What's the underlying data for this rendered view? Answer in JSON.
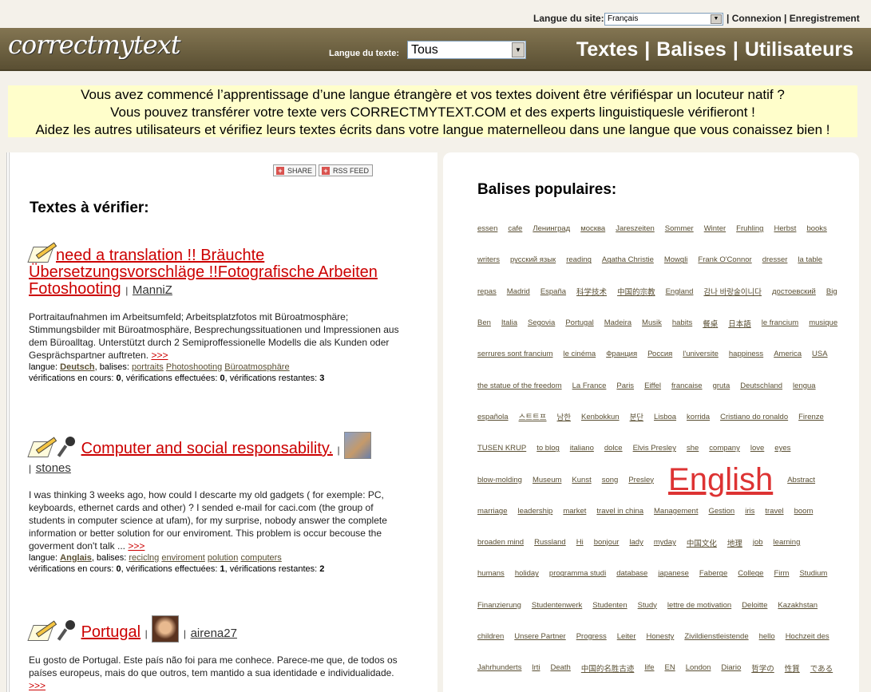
{
  "topbar": {
    "site_lang_label": "Langue du site:",
    "site_lang_value": "Français",
    "login": "Connexion",
    "register": "Enregistrement"
  },
  "header": {
    "logo": "correctmytext",
    "text_lang_label": "Langue du texte:",
    "text_lang_value": "Tous",
    "nav": [
      "Textes",
      "Balises",
      "Utilisateurs"
    ]
  },
  "banner": {
    "line1": "Vous avez commencé l’apprentissage d’une langue étrangère et vos textes doivent être vérifiéspar un locuteur natif ?",
    "line2": "Vous pouvez transférer votre texte vers CORRECTMYTEXT.COM et des experts linguistiquesle vérifieront !",
    "line3": "Aidez les autres utilisateurs et vérifiez leurs textes écrits dans votre langue maternelleou dans une langue que vous conaissez bien !"
  },
  "share": {
    "share_label": "SHARE",
    "rss_label": "RSS FEED"
  },
  "left": {
    "heading": "Textes à vérifier:",
    "entries": [
      {
        "title": "need a translation !! Bräuchte Übersetzungsvorschläge !!Fotografische Arbeiten Fotoshooting",
        "user": "ManniZ",
        "desc": "Portraitaufnahmen im Arbeitsumfeld; Arbeitsplatzfotos mit Büroatmosphäre; Stimmungsbilder mit Büroatmosphäre, Besprechungssituationen und Impressionen aus dem Büroalltag. Unterstützt durch 2 Semiproffessionelle Modells die als Kunden oder Gesprächspartner auftreten.",
        "more": ">>>",
        "lang": "Deutsch",
        "tags": [
          "portraits",
          "Photoshooting",
          "Büroatmosphäre"
        ],
        "in_progress": "0",
        "done": "0",
        "remaining": "3"
      },
      {
        "title": "Computer and social responsability.",
        "user": "stones",
        "desc": "I was thinking 3 weeks ago, how could I descarte my old gadgets ( for exemple: PC, keyboards, ethernet cards and other) ? I sended e-mail for caci.com (the group of students in computer science at ufam), for my surprise, nobody answer the complete information or better solution for our enviroment. This problem is occur becouse the goverment don't talk ...",
        "more": ">>>",
        "lang": "Anglais",
        "tags": [
          "reciclng",
          "enviroment",
          "polution",
          "computers"
        ],
        "in_progress": "0",
        "done": "1",
        "remaining": "2"
      },
      {
        "title": "Portugal",
        "user": "airena27",
        "desc": "Eu gosto de Portugal. Este país não foi para me conhece. Parece-me que, de todos os países europeus, mais do que outros, tem mantido a sua identidade e individualidade.",
        "more": ">>>"
      }
    ],
    "labels": {
      "lang": "langue:",
      "tags": "balises:",
      "in_progress": "vérifications en cours:",
      "done": "vérifications effectuées:",
      "remaining": "vérifications restantes:"
    }
  },
  "right": {
    "heading": "Balises populaires:",
    "tag_rows": [
      [
        "essen",
        "cafe",
        "Ленинград",
        "москва",
        "Jareszeiten",
        "Sommer",
        "Winter",
        "Fruhling",
        "Herbst",
        "books"
      ],
      [
        "writers",
        "русский язык",
        "reading",
        "Agatha Christie",
        "Mowgli",
        "Frank O'Connor",
        "dresser",
        "la table"
      ],
      [
        "repas",
        "Madrid",
        "España",
        "科学技术",
        "中国的宗教",
        "England",
        "감나 바랑술이니다",
        "достоевский",
        "Big"
      ],
      [
        "Ben",
        "Italia",
        "Segovia",
        "Portugal",
        "Madeira",
        "Musik",
        "habits",
        "餐桌",
        "日本語",
        "le francium",
        "musique"
      ],
      [
        "serrures sont francium",
        "le cinéma",
        "Франция",
        "Россия",
        "l'universite",
        "happiness",
        "America",
        "USA"
      ],
      [
        "the statue of the freedom",
        "La France",
        "Paris",
        "Eiffel",
        "francaise",
        "gruta",
        "Deutschland",
        "lengua"
      ],
      [
        "española",
        "스트트프",
        "남한",
        "Kenbokkun",
        "분단",
        "Lisboa",
        "korrida",
        "Cristiano do ronaldo",
        "Firenze"
      ],
      [
        "TUSEN KRUP",
        "to blog",
        "italiano",
        "dolce",
        "Elvis Presley",
        "she",
        "company",
        "love",
        "eyes"
      ],
      [
        "blow-molding",
        "Museum",
        "Kunst",
        "song",
        "Presley",
        "English",
        "Abstract"
      ],
      [
        "marriage",
        "leadership",
        "market",
        "travel in china",
        "Management",
        "Gestion",
        "iris",
        "travel",
        "boom"
      ],
      [
        "broaden mind",
        "Russland",
        "Hi",
        "bonjour",
        "lady",
        "myday",
        "中国文化",
        "地理",
        "job",
        "learning"
      ],
      [
        "humans",
        "holiday",
        "programma studi",
        "database",
        "japanese",
        "Faberge",
        "College",
        "Firm",
        "Studium"
      ],
      [
        "Finanzierung",
        "Studentenwerk",
        "Studenten",
        "Study",
        "lettre de motivation",
        "Deloitte",
        "Kazakhstan"
      ],
      [
        "children",
        "Unsere Partner",
        "Progress",
        "Leiter",
        "Honesty",
        "Zivildienstleistende",
        "hello",
        "Hochzeit des"
      ],
      [
        "Jahrhunderts",
        "lrti",
        "Death",
        "中国的名胜古迹",
        "life",
        "EN",
        "London",
        "Diario",
        "哲学の",
        "性質",
        "である"
      ]
    ],
    "big_tag": "English"
  },
  "colors": {
    "header_bg": "#6e6242",
    "banner_bg": "#fffecb",
    "title_red": "#cc0000",
    "tag_brown": "#5a4f33"
  }
}
